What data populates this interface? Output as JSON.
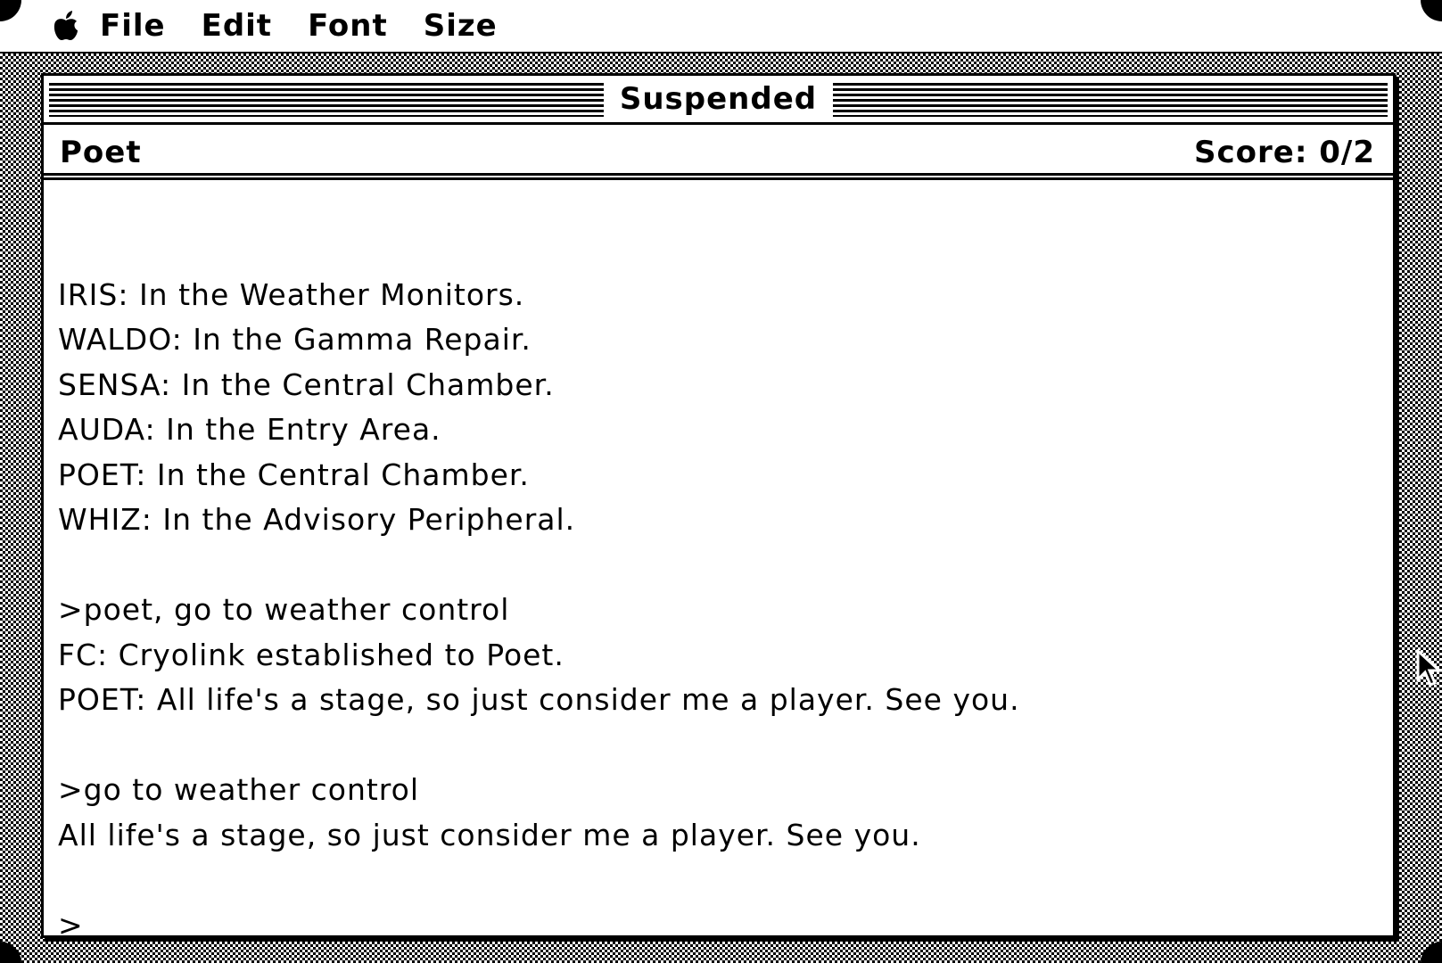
{
  "menubar": {
    "apple_icon": "apple-menu-icon",
    "items": [
      "File",
      "Edit",
      "Font",
      "Size"
    ]
  },
  "window": {
    "title": "Suspended",
    "status": {
      "left": "Poet",
      "right": "Score: 0/2"
    },
    "transcript": [
      "",
      "IRIS: In the Weather Monitors.",
      "WALDO: In the Gamma Repair.",
      "SENSA: In the Central Chamber.",
      "AUDA: In the Entry Area.",
      "POET: In the Central Chamber.",
      "WHIZ: In the Advisory Peripheral.",
      "",
      ">poet, go to weather control",
      "FC: Cryolink established to Poet.",
      "POET: All life's a stage, so just consider me a player. See you.",
      "",
      ">go to weather control",
      "All life's a stage, so just consider me a player. See you.",
      "",
      ">"
    ]
  },
  "cursor": "arrow-pointer"
}
